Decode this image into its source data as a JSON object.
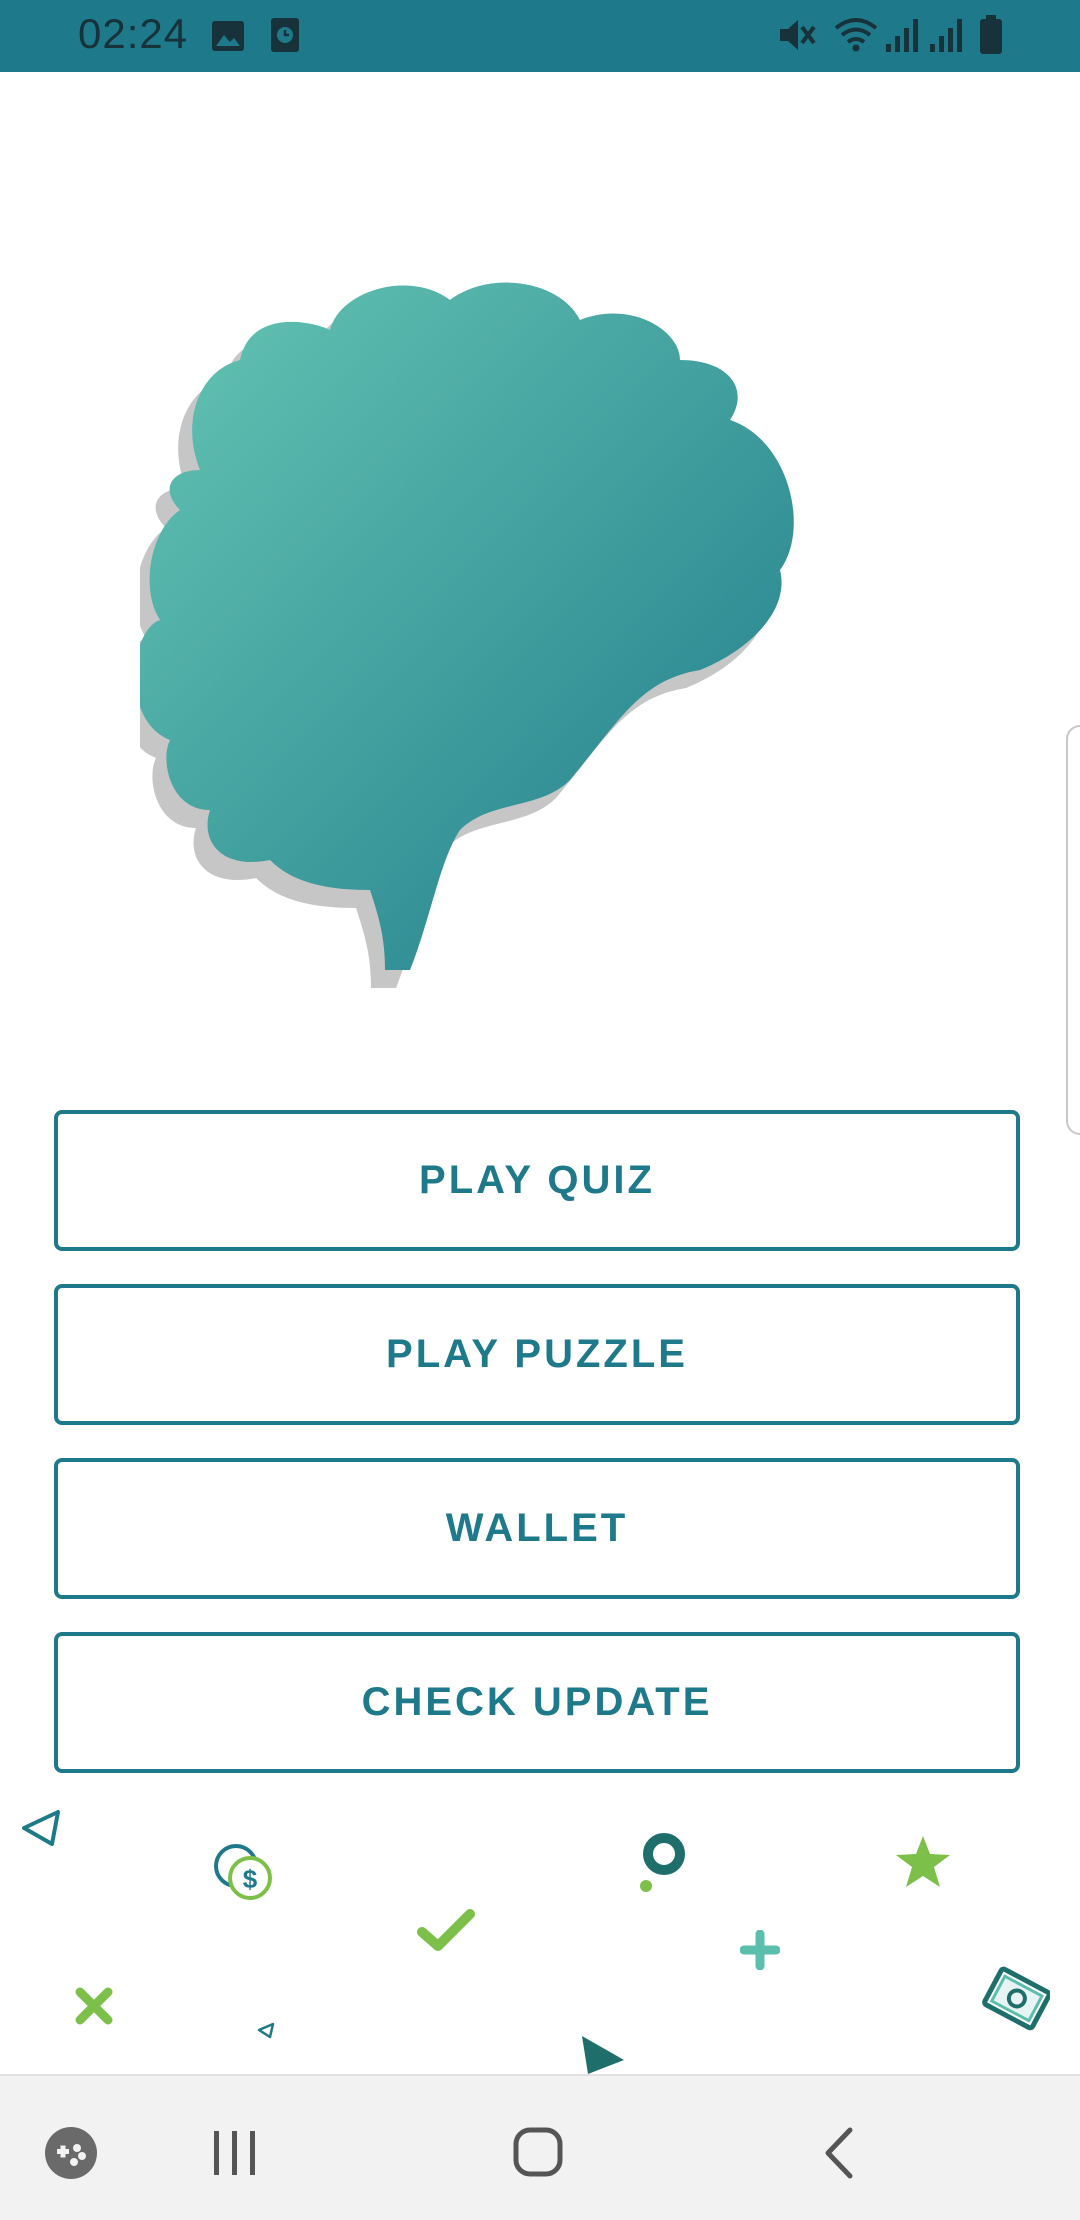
{
  "status_bar": {
    "time": "02:24",
    "left_icons": [
      "image-icon",
      "alarm-icon"
    ],
    "right_icons": [
      "mute-icon",
      "wifi-icon",
      "signal-icon",
      "signal-icon",
      "battery-icon"
    ],
    "background_color": "#1e7a8a"
  },
  "logo": {
    "name": "brain-logo-icon",
    "gradient": [
      "#66c6b4",
      "#1e7a8a"
    ]
  },
  "menu": {
    "buttons": [
      {
        "label": "PLAY QUIZ"
      },
      {
        "label": "PLAY PUZZLE"
      },
      {
        "label": "WALLET"
      },
      {
        "label": "CHECK UPDATE"
      }
    ],
    "accent_color": "#1e7a8a"
  },
  "decorations": [
    "triangle-outline-icon",
    "coins-icon",
    "ring-icon",
    "star-icon",
    "checkmark-icon",
    "plus-icon",
    "cross-icon",
    "small-triangle-icon",
    "play-triangle-icon",
    "money-icon"
  ],
  "nav_bar": {
    "items": [
      "game-launcher-icon",
      "recent-apps-icon",
      "home-icon",
      "back-icon"
    ]
  }
}
